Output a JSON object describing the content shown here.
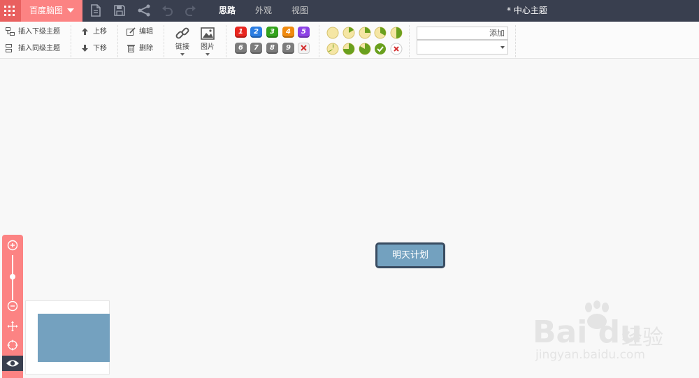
{
  "topbar": {
    "brand": "百度脑图",
    "tabs": [
      "思路",
      "外观",
      "视图"
    ],
    "doc_title": "* 中心主题"
  },
  "ribbon": {
    "insert_child": "插入下级主题",
    "insert_sibling": "插入同级主题",
    "move_up": "上移",
    "move_down": "下移",
    "edit": "编辑",
    "delete": "删除",
    "link": "链接",
    "image": "图片",
    "priorities": [
      {
        "label": "1",
        "color": "#e8261f"
      },
      {
        "label": "2",
        "color": "#2b7de2"
      },
      {
        "label": "3",
        "color": "#33a31c"
      },
      {
        "label": "4",
        "color": "#f08a0e"
      },
      {
        "label": "5",
        "color": "#8c42e5"
      },
      {
        "label": "6",
        "color": "#7c7c7c"
      },
      {
        "label": "7",
        "color": "#7c7c7c"
      },
      {
        "label": "8",
        "color": "#7c7c7c"
      },
      {
        "label": "9",
        "color": "#7c7c7c"
      }
    ],
    "resource_add": "添加"
  },
  "canvas": {
    "node_text": "明天计划"
  },
  "watermark": {
    "brand": "Bai du",
    "cn": "经验",
    "url": "jingyan.baidu.com"
  },
  "colors": {
    "topbar": "#393f4f",
    "accent": "#fc8383",
    "node_fill": "#73a1bf",
    "node_border": "#394c61"
  }
}
